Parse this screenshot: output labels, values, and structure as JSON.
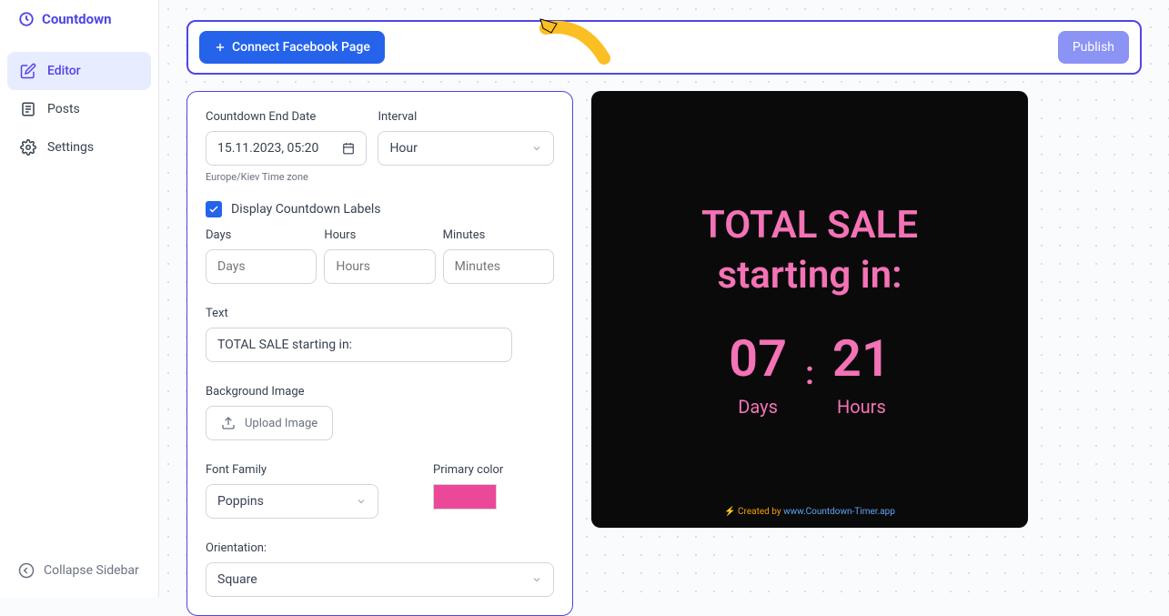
{
  "app": {
    "name": "Countdown"
  },
  "nav": {
    "editor": "Editor",
    "posts": "Posts",
    "settings": "Settings"
  },
  "collapse": "Collapse Sidebar",
  "topbar": {
    "connect": "Connect Facebook Page",
    "publish": "Publish"
  },
  "form": {
    "endDateLabel": "Countdown End Date",
    "endDateValue": "15.11.2023, 05:20",
    "intervalLabel": "Interval",
    "intervalValue": "Hour",
    "timezone": "Europe/Kiev Time zone",
    "displayLabels": "Display Countdown Labels",
    "daysLabel": "Days",
    "daysPlaceholder": "Days",
    "hoursLabel": "Hours",
    "hoursPlaceholder": "Hours",
    "minutesLabel": "Minutes",
    "minutesPlaceholder": "Minutes",
    "textLabel": "Text",
    "textValue": "TOTAL SALE starting in:",
    "bgImageLabel": "Background Image",
    "uploadImage": "Upload Image",
    "fontLabel": "Font Family",
    "fontValue": "Poppins",
    "colorLabel": "Primary color",
    "colorValue": "#ec4899",
    "orientationLabel": "Orientation:",
    "orientationValue": "Square"
  },
  "preview": {
    "textLine1": "TOTAL SALE",
    "textLine2": "starting in:",
    "days": "07",
    "hours": "21",
    "daysLabel": "Days",
    "hoursLabel": "Hours",
    "footerPrefix": "⚡ Created by ",
    "footerLink": "www.Countdown-Timer.app"
  }
}
